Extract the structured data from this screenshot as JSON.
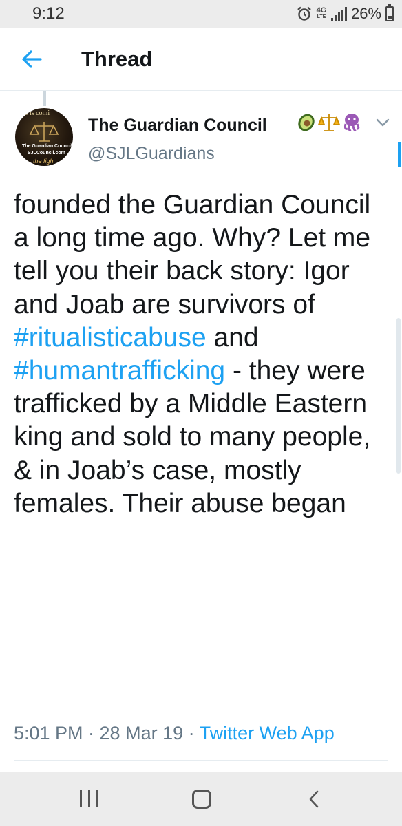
{
  "status_bar": {
    "time": "9:12",
    "network": "4G",
    "network_sub": "LTE",
    "battery": "26%"
  },
  "header": {
    "title": "Thread"
  },
  "tweet": {
    "display_name": "The Guardian Council",
    "handle": "@SJLGuardians",
    "avatar_text": {
      "line1": "e is comi",
      "line2": "The Guardian Council",
      "line3": "SJLCouncil.com",
      "line4": "the figh"
    },
    "body_segments": [
      {
        "text": "founded the Guardian Council a long time ago. Why? Let me tell you their back story: Igor and Joab are survivors of ",
        "type": "text"
      },
      {
        "text": "#ritualisticabuse",
        "type": "hashtag"
      },
      {
        "text": " and ",
        "type": "text"
      },
      {
        "text": "#humantrafficking",
        "type": "hashtag"
      },
      {
        "text": " - they were trafficked by a Middle Eastern king and sold to many people, & in Joab’s case, mostly females. Their abuse began",
        "type": "text"
      }
    ],
    "timestamp": "5:01 PM · 28 Mar 19 · ",
    "source": "Twitter Web App"
  },
  "colors": {
    "accent": "#1da1f2",
    "text_primary": "#14171a",
    "text_secondary": "#657786",
    "system_bar": "#ececec"
  },
  "icons": [
    "back-arrow-icon",
    "alarm-icon",
    "signal-icon",
    "battery-icon",
    "avocado-emoji-icon",
    "scales-emoji-icon",
    "octopus-emoji-icon",
    "chevron-down-icon",
    "recent-apps-icon",
    "home-icon",
    "back-nav-icon"
  ]
}
